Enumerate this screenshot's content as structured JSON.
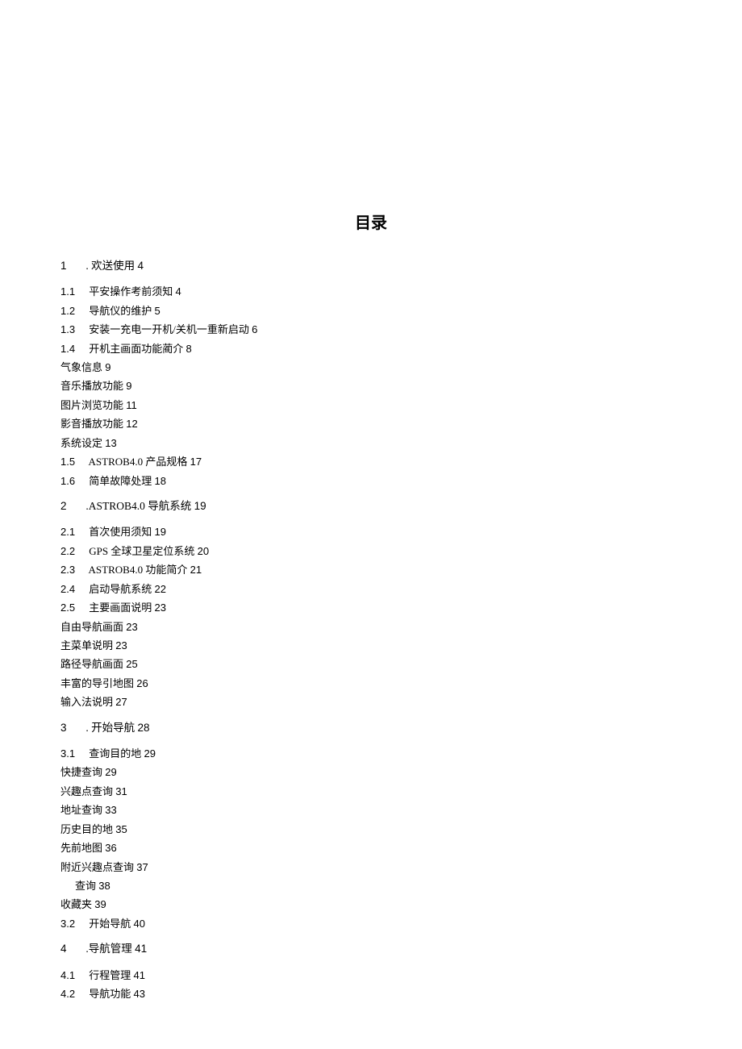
{
  "title": "目录",
  "entries": [
    {
      "type": "h1",
      "num": "1",
      "sep": " . ",
      "text": "欢送使用",
      "page": "4"
    },
    {
      "type": "h2",
      "num": "1.1",
      "text": "平安操作考前须知",
      "page": "4"
    },
    {
      "type": "h2",
      "num": "1.2",
      "text": "导航仪的维护",
      "page": "5"
    },
    {
      "type": "h2",
      "num": "1.3",
      "text": "安装一充电一开机/关机一重新启动",
      "page": "6"
    },
    {
      "type": "h2",
      "num": "1.4",
      "text": "开机主画面功能蔺介",
      "page": "8"
    },
    {
      "type": "h3",
      "text": "气象信息",
      "page": "9"
    },
    {
      "type": "h3",
      "text": "音乐播放功能",
      "page": "9"
    },
    {
      "type": "h3",
      "text": "图片浏览功能",
      "page": "11"
    },
    {
      "type": "h3",
      "text": "影音播放功能",
      "page": "12"
    },
    {
      "type": "h3",
      "text": "系统设定",
      "page": "13"
    },
    {
      "type": "h2",
      "num": "1.5",
      "text": "ASTROB4.0 产品规格",
      "page": "17"
    },
    {
      "type": "h2",
      "num": "1.6",
      "text": "简单故障处理",
      "page": "18"
    },
    {
      "type": "h1",
      "num": "2",
      "sep": "    .",
      "text": "ASTROB4.0 导航系统",
      "page": "19"
    },
    {
      "type": "h2",
      "num": "2.1",
      "text": "首次使用须知",
      "page": "19"
    },
    {
      "type": "h2",
      "num": "2.2",
      "text": "GPS 全球卫星定位系统",
      "page": "20"
    },
    {
      "type": "h2",
      "num": "2.3",
      "text": "ASTROB4.0 功能简介",
      "page": "21"
    },
    {
      "type": "h2",
      "num": "2.4",
      "text": "启动导航系统",
      "page": "22"
    },
    {
      "type": "h2",
      "num": "2.5",
      "text": "主要画面说明",
      "page": "23"
    },
    {
      "type": "h3",
      "text": "自由导航画面",
      "page": "23"
    },
    {
      "type": "h3",
      "text": "主菜单说明",
      "page": "23"
    },
    {
      "type": "h3",
      "text": "路径导航画面",
      "page": "25"
    },
    {
      "type": "h3",
      "text": "丰富的导引地图",
      "page": "26"
    },
    {
      "type": "h3",
      "text": "输入法说明",
      "page": "27"
    },
    {
      "type": "h1",
      "num": "3",
      "sep": "    . ",
      "text": "开始导航",
      "page": "28"
    },
    {
      "type": "h2",
      "num": "3.1",
      "text": "查询目的地",
      "page": "29"
    },
    {
      "type": "h3",
      "text": "快捷查询",
      "page": "29"
    },
    {
      "type": "h3",
      "text": "兴趣点查询",
      "page": "31"
    },
    {
      "type": "h3",
      "text": "地址查询",
      "page": "33"
    },
    {
      "type": "h3",
      "text": "历史目的地",
      "page": "35"
    },
    {
      "type": "h3",
      "text": "先前地图",
      "page": "36"
    },
    {
      "type": "h3",
      "text": "附近兴趣点查询",
      "page": "37"
    },
    {
      "type": "h3-indent",
      "text": "查询",
      "page": "38"
    },
    {
      "type": "h3",
      "text": "收藏夹",
      "page": "39"
    },
    {
      "type": "h2",
      "num": "3.2",
      "text": "开始导航",
      "page": "40"
    },
    {
      "type": "h1",
      "num": "4",
      "sep": "    .",
      "text": "导航管理",
      "page": "41"
    },
    {
      "type": "h2",
      "num": "4.1",
      "text": "行程管理",
      "page": "41"
    },
    {
      "type": "h2",
      "num": "4.2",
      "text": "导航功能",
      "page": "43"
    }
  ]
}
